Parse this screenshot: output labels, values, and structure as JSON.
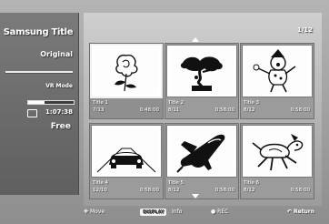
{
  "sidebar": {
    "title": "Samsung Title Original",
    "title_line1": "Samsung Title",
    "title_line2": "Original",
    "mode": "VR Mode",
    "time_remaining": "1:07:38",
    "free_label": "Free",
    "usage_fraction": 0.35
  },
  "main": {
    "page_indicator": "1/12",
    "tiles": [
      {
        "label": "Title 1",
        "date": "7/13",
        "duration": "0:48:00",
        "icon": "rose-icon"
      },
      {
        "label": "Title 2",
        "date": "8/11",
        "duration": "0:58:00",
        "icon": "bonsai-icon"
      },
      {
        "label": "Title 3",
        "date": "8/12",
        "duration": "0:58:00",
        "icon": "clown-icon"
      },
      {
        "label": "Title 4",
        "date": "12/10",
        "duration": "0:58:00",
        "icon": "car-icon"
      },
      {
        "label": "Title 5",
        "date": "8/12",
        "duration": "0:58:00",
        "icon": "space-shuttle-icon"
      },
      {
        "label": "Title 6",
        "date": "8/12",
        "duration": "0:58:00",
        "icon": "dog-icon"
      }
    ]
  },
  "help": {
    "move": "Move",
    "display_key": "DISPLAY",
    "info": "Info",
    "rec": "REC",
    "return": "Return"
  }
}
